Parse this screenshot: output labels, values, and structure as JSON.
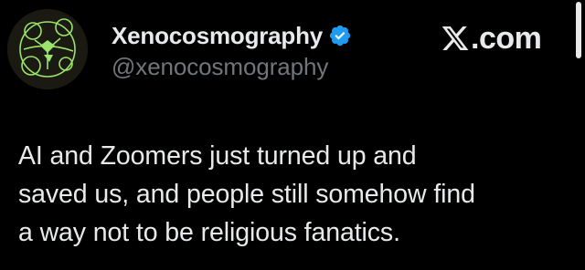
{
  "author": {
    "display_name": "Xenocosmography",
    "handle": "@xenocosmography",
    "verified": true,
    "verified_color": "#1d9bf0"
  },
  "source": {
    "label": ".com",
    "logo_icon": "x-logo-icon"
  },
  "tweet": {
    "text": "AI and Zoomers just turned up and\nsaved us, and people still somehow find\na way not to be religious fanatics."
  },
  "colors": {
    "background": "#000000",
    "text": "#e7e9ea",
    "handle": "#71767b",
    "avatar_line": "#9be36a"
  }
}
